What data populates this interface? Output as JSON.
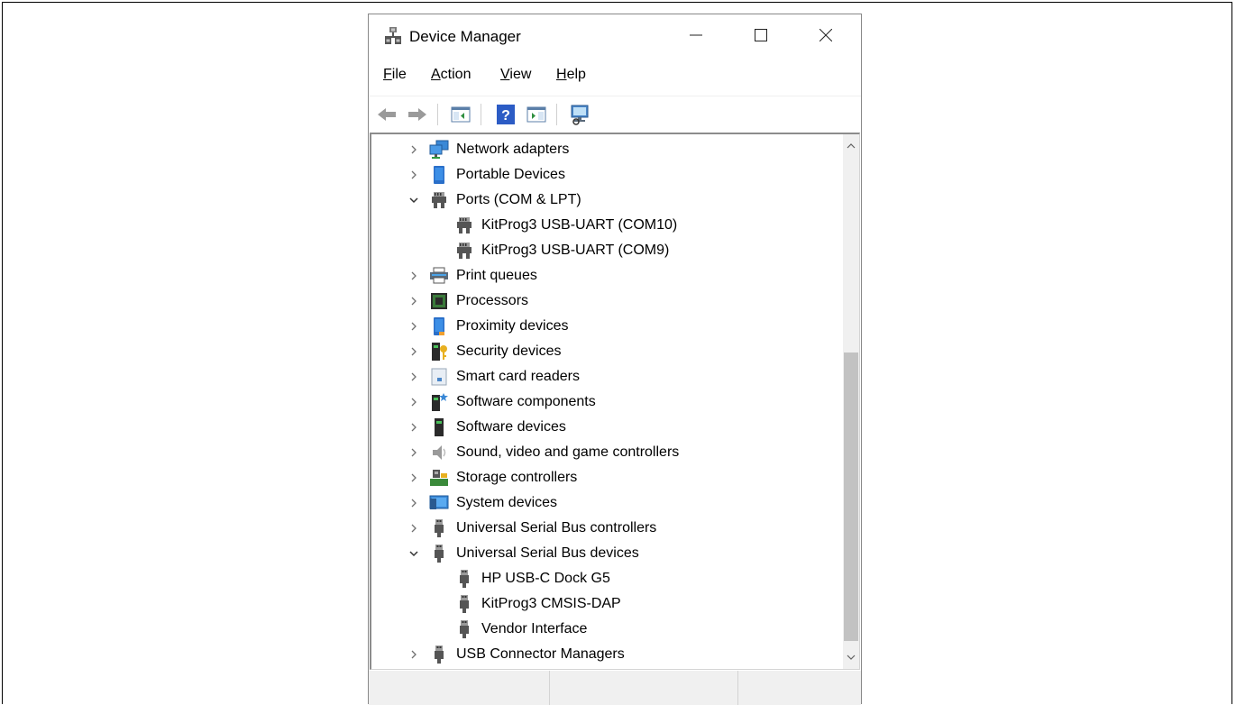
{
  "window": {
    "title": "Device Manager",
    "icon": "device-manager-icon",
    "controls": {
      "minimize": "minimize-icon",
      "maximize": "maximize-icon",
      "close": "close-icon"
    }
  },
  "menu": [
    {
      "accel": "F",
      "rest": "ile"
    },
    {
      "accel": "A",
      "rest": "ction"
    },
    {
      "accel": "V",
      "rest": "iew"
    },
    {
      "accel": "H",
      "rest": "elp"
    }
  ],
  "toolbar": [
    "back-arrow-icon",
    "forward-arrow-icon",
    "show-hide-console-tree-icon",
    "help-icon",
    "properties-icon",
    "scan-hardware-icon"
  ],
  "tree": [
    {
      "label": "Network adapters",
      "level": 0,
      "state": "collapsed",
      "icon": "network-adapter-icon"
    },
    {
      "label": "Portable Devices",
      "level": 0,
      "state": "collapsed",
      "icon": "portable-device-icon"
    },
    {
      "label": "Ports (COM & LPT)",
      "level": 0,
      "state": "expanded",
      "icon": "port-icon"
    },
    {
      "label": "KitProg3 USB-UART (COM10)",
      "level": 1,
      "state": "leaf",
      "icon": "port-icon"
    },
    {
      "label": "KitProg3 USB-UART (COM9)",
      "level": 1,
      "state": "leaf",
      "icon": "port-icon"
    },
    {
      "label": "Print queues",
      "level": 0,
      "state": "collapsed",
      "icon": "printer-icon"
    },
    {
      "label": "Processors",
      "level": 0,
      "state": "collapsed",
      "icon": "processor-icon"
    },
    {
      "label": "Proximity devices",
      "level": 0,
      "state": "collapsed",
      "icon": "proximity-device-icon"
    },
    {
      "label": "Security devices",
      "level": 0,
      "state": "collapsed",
      "icon": "security-device-icon"
    },
    {
      "label": "Smart card readers",
      "level": 0,
      "state": "collapsed",
      "icon": "smart-card-reader-icon"
    },
    {
      "label": "Software components",
      "level": 0,
      "state": "collapsed",
      "icon": "software-component-icon"
    },
    {
      "label": "Software devices",
      "level": 0,
      "state": "collapsed",
      "icon": "software-device-icon"
    },
    {
      "label": "Sound, video and game controllers",
      "level": 0,
      "state": "collapsed",
      "icon": "speaker-icon"
    },
    {
      "label": "Storage controllers",
      "level": 0,
      "state": "collapsed",
      "icon": "storage-controller-icon"
    },
    {
      "label": "System devices",
      "level": 0,
      "state": "collapsed",
      "icon": "system-device-icon"
    },
    {
      "label": "Universal Serial Bus controllers",
      "level": 0,
      "state": "collapsed",
      "icon": "usb-icon"
    },
    {
      "label": "Universal Serial Bus devices",
      "level": 0,
      "state": "expanded",
      "icon": "usb-icon"
    },
    {
      "label": "HP USB-C Dock G5",
      "level": 1,
      "state": "leaf",
      "icon": "usb-icon"
    },
    {
      "label": "KitProg3 CMSIS-DAP",
      "level": 1,
      "state": "leaf",
      "icon": "usb-icon"
    },
    {
      "label": "Vendor Interface",
      "level": 1,
      "state": "leaf",
      "icon": "usb-icon"
    },
    {
      "label": "USB Connector Managers",
      "level": 0,
      "state": "collapsed",
      "icon": "usb-icon"
    }
  ],
  "scrollbar": {
    "up": "scroll-up-arrow-icon",
    "down": "scroll-down-arrow-icon"
  }
}
